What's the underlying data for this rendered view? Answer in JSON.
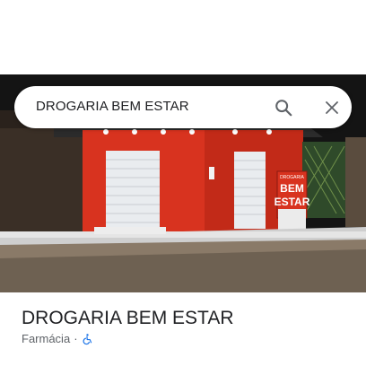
{
  "search": {
    "query": "DROGARIA BEM ESTAR",
    "search_icon": "search-icon",
    "close_icon": "close-icon"
  },
  "photo": {
    "sign_line1": "DROGARIA",
    "sign_line2": "BEM",
    "sign_line3": "ESTAR",
    "storefront_color": "#d8331f"
  },
  "place": {
    "name": "DROGARIA BEM ESTAR",
    "category": "Farmácia",
    "separator": "·",
    "accessibility_icon": "wheelchair-icon",
    "accessibility_color": "#1a73e8"
  }
}
